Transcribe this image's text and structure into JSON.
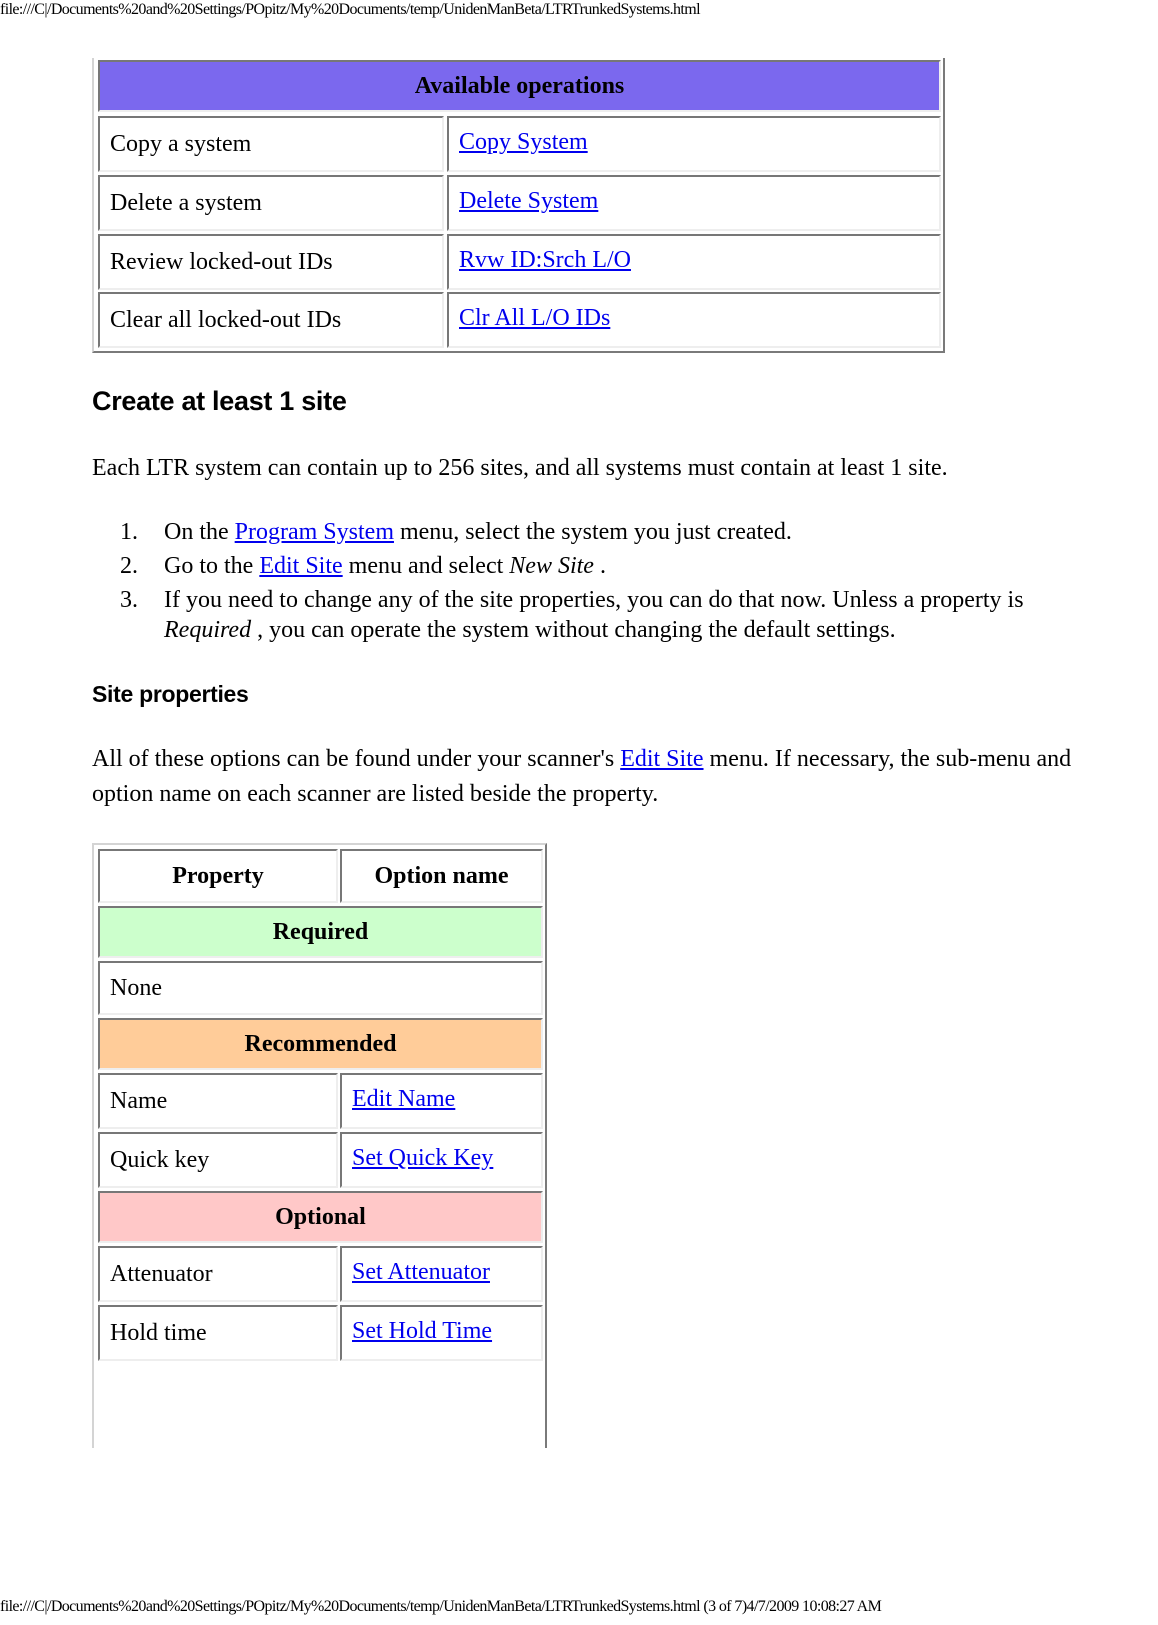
{
  "page": {
    "header_url": "file:///C|/Documents%20and%20Settings/POpitz/My%20Documents/temp/UnidenManBeta/LTRTrunkedSystems.html",
    "footer_text": "file:///C|/Documents%20and%20Settings/POpitz/My%20Documents/temp/UnidenManBeta/LTRTrunkedSystems.html (3 of 7)4/7/2009 10:08:27 AM"
  },
  "operations_table": {
    "header": "Available operations",
    "header_color": "#7b68ee",
    "rows": [
      {
        "operation": "Copy a system",
        "link": "Copy System"
      },
      {
        "operation": "Delete a system",
        "link": "Delete System"
      },
      {
        "operation": "Review locked-out IDs",
        "link": "Rvw ID:Srch L/O"
      },
      {
        "operation": "Clear all locked-out IDs",
        "link": "Clr All L/O IDs"
      }
    ]
  },
  "create_site": {
    "heading": "Create at least 1 site",
    "intro": "Each LTR system can contain up to 256 sites, and all systems must contain at least 1 site.",
    "steps": [
      {
        "num": "1.",
        "pre": "On the ",
        "link": "Program System",
        "post": " menu, select the system you just created."
      },
      {
        "num": "2.",
        "pre": "Go to the ",
        "link": "Edit Site",
        "post": " menu and select ",
        "italic": "New Site",
        "post2": " ."
      },
      {
        "num": "3.",
        "line1": "If you need to change any of the site properties, you can do that now. Unless a property is",
        "italic": "Required",
        "line2": " , you can operate the system without changing the default settings."
      }
    ]
  },
  "site_properties": {
    "heading": "Site properties",
    "intro_pre": "All of these options can be found under your scanner's ",
    "intro_link": "Edit Site",
    "intro_post": " menu. If necessary, the sub-menu and",
    "intro_line2": "option name on each scanner are listed beside the property."
  },
  "properties_table": {
    "col_property": "Property",
    "col_option": "Option name",
    "sections": [
      {
        "label": "Required",
        "color": "#ccffcc",
        "rows": [
          {
            "property": "None",
            "option": ""
          }
        ]
      },
      {
        "label": "Recommended",
        "color": "#ffcc99",
        "rows": [
          {
            "property": "Name",
            "option": "Edit Name"
          },
          {
            "property": "Quick key",
            "option": "Set Quick Key"
          }
        ]
      },
      {
        "label": "Optional",
        "color": "#ffc8c8",
        "rows": [
          {
            "property": "Attenuator",
            "option": "Set Attenuator"
          },
          {
            "property": "Hold time",
            "option": "Set Hold Time"
          }
        ]
      }
    ]
  }
}
